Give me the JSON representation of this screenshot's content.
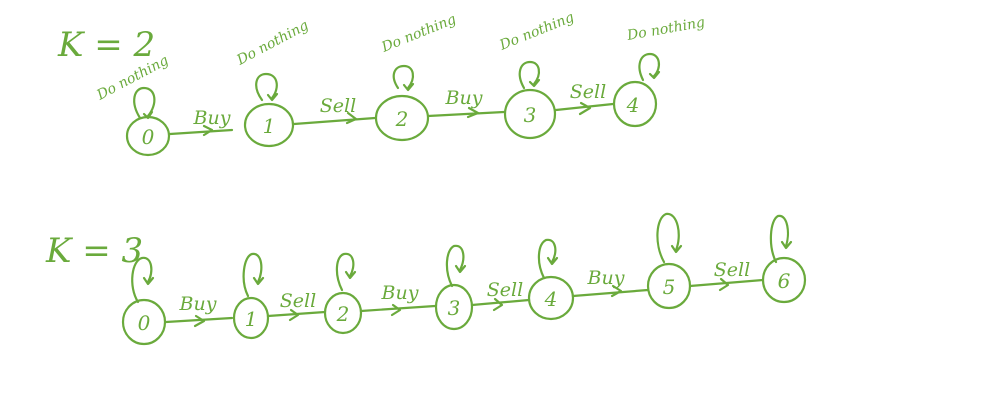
{
  "diagrams": [
    {
      "k_label": "K = 2",
      "nodes": [
        "0",
        "1",
        "2",
        "3",
        "4"
      ],
      "edges": [
        "Buy",
        "Sell",
        "Buy",
        "Sell"
      ],
      "self_loop_labels": [
        "Do nothing",
        "Do nothing",
        "Do nothing",
        "Do nothing",
        "Do nothing"
      ]
    },
    {
      "k_label": "K = 3",
      "nodes": [
        "0",
        "1",
        "2",
        "3",
        "4",
        "5",
        "6"
      ],
      "edges": [
        "Buy",
        "Sell",
        "Buy",
        "Sell",
        "Buy",
        "Sell"
      ],
      "self_loop_labels": []
    }
  ],
  "ink_color": "#6aaa3c"
}
